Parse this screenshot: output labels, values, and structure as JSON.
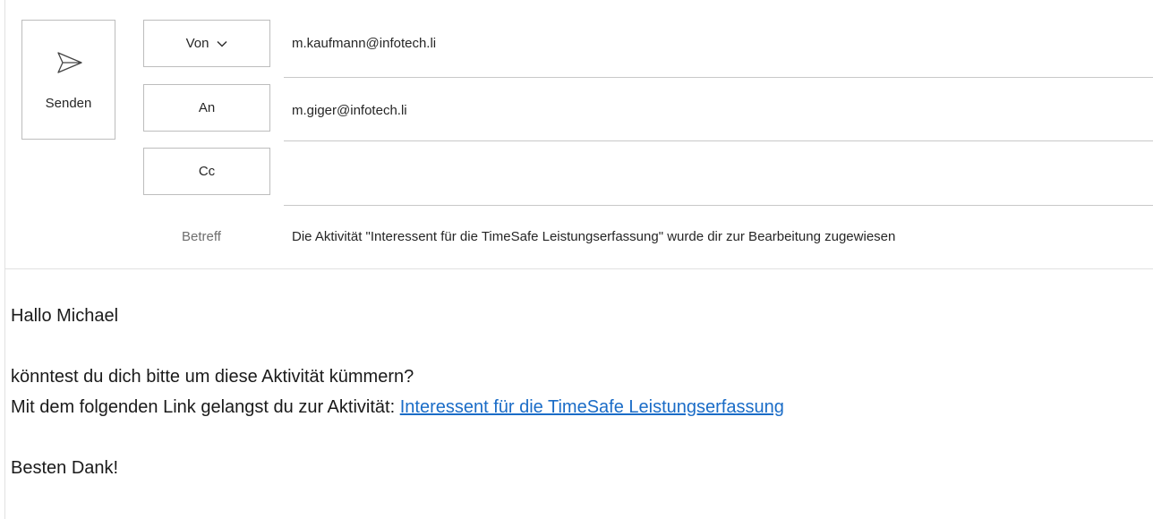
{
  "compose": {
    "send_label": "Senden",
    "from_label": "Von",
    "from_value": "m.kaufmann@infotech.li",
    "to_label": "An",
    "to_value": "m.giger@infotech.li",
    "cc_label": "Cc",
    "cc_value": "",
    "subject_label": "Betreff",
    "subject_value": "Die Aktivität \"Interessent für die TimeSafe Leistungserfassung\" wurde dir zur Bearbeitung zugewiesen"
  },
  "message": {
    "greeting": "Hallo Michael",
    "line1": "könntest du dich bitte um diese Aktivität kümmern?",
    "line2_prefix": "Mit dem folgenden Link gelangst du zur Aktivität:",
    "link_text": "Interessent für die TimeSafe Leistungserfassung",
    "closing": "Besten Dank!"
  },
  "icons": {
    "send": "send-icon",
    "from_dropdown": "chevron-down-icon"
  },
  "colors": {
    "link": "#1a6cc7",
    "border": "#bdbdbd",
    "muted_label": "#6e6e6e"
  }
}
